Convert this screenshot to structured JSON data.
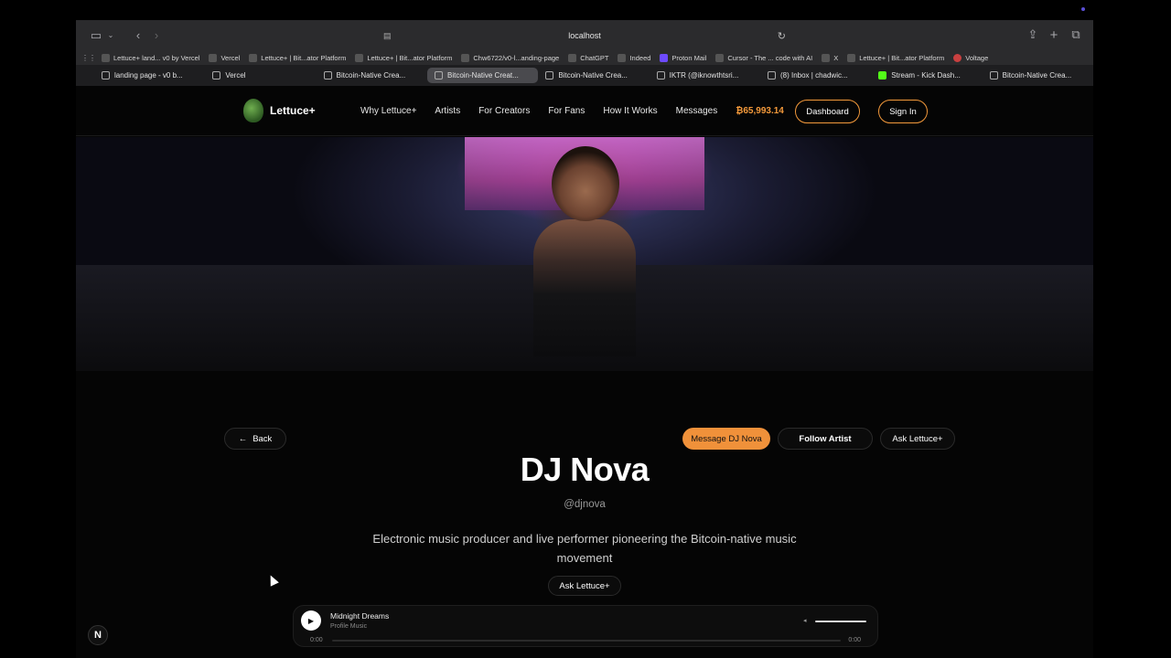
{
  "browser": {
    "url": "localhost",
    "bookmarks": [
      {
        "label": "Lettuce+ land... v0 by Vercel"
      },
      {
        "label": "Vercel"
      },
      {
        "label": "Lettuce+ | Bit...ator Platform"
      },
      {
        "label": "Lettuce+ | Bit...ator Platform"
      },
      {
        "label": "Chw6722/v0-l...anding-page"
      },
      {
        "label": "ChatGPT"
      },
      {
        "label": "Indeed"
      },
      {
        "label": "Proton Mail"
      },
      {
        "label": "Cursor - The ... code with AI"
      },
      {
        "label": "X"
      },
      {
        "label": "Lettuce+ | Bit...ator Platform"
      },
      {
        "label": "Voltage"
      }
    ],
    "tabs": [
      {
        "label": "landing page - v0 b..."
      },
      {
        "label": "Vercel"
      },
      {
        "label": "Bitcoin-Native Crea..."
      },
      {
        "label": "Bitcoin-Native Creat...",
        "active": true
      },
      {
        "label": "Bitcoin-Native Crea..."
      },
      {
        "label": "IKTR (@iknowthtsri..."
      },
      {
        "label": "(8) Inbox | chadwic..."
      },
      {
        "label": "Stream - Kick Dash..."
      },
      {
        "label": "Bitcoin-Native Crea..."
      }
    ]
  },
  "nav": {
    "brand": "Lettuce+",
    "links": [
      "Why Lettuce+",
      "Artists",
      "For Creators",
      "For Fans",
      "How It Works",
      "Messages"
    ],
    "btc_balance": "₿65,993.14",
    "dashboard": "Dashboard",
    "signin": "Sign In"
  },
  "profile": {
    "back": "Back",
    "message": "Message DJ Nova",
    "follow": "Follow Artist",
    "ask": "Ask Lettuce+",
    "name": "DJ Nova",
    "handle": "@djnova",
    "bio": "Electronic music producer and live performer pioneering the Bitcoin-native music movement",
    "ask_below": "Ask Lettuce+"
  },
  "player": {
    "track": "Midnight Dreams",
    "source": "Profile Music",
    "elapsed": "0:00",
    "duration": "0:00",
    "progress": 0,
    "volume": 1.0
  },
  "colors": {
    "accent": "#f59a3b",
    "background": "#050505"
  }
}
